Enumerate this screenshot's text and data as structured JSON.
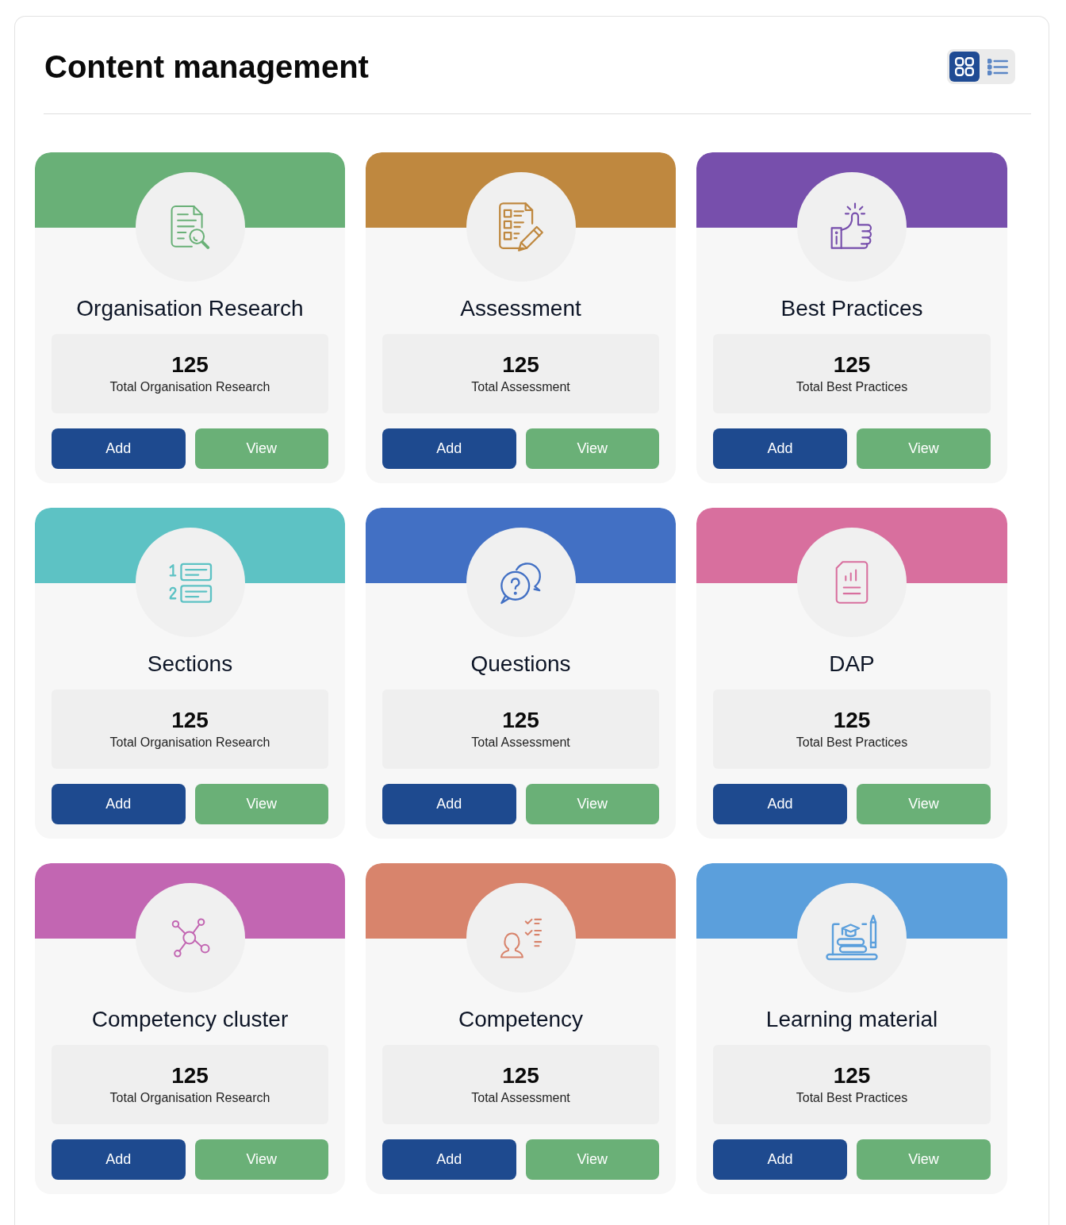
{
  "header": {
    "title": "Content management",
    "view_toggle": [
      {
        "kind": "grid",
        "selected": true
      },
      {
        "kind": "list",
        "selected": false
      }
    ]
  },
  "cards": [
    {
      "kind": "research",
      "title": "Organisation Research",
      "color": "#69b077",
      "count": "125",
      "count_label": "Total Organisation Research",
      "actions": [
        {
          "kind": "add",
          "label": "Add"
        },
        {
          "kind": "view",
          "label": "View"
        }
      ]
    },
    {
      "kind": "assessment",
      "title": "Assessment",
      "color": "#bf883f",
      "count": "125",
      "count_label": "Total Assessment",
      "actions": [
        {
          "kind": "add",
          "label": "Add"
        },
        {
          "kind": "view",
          "label": "View"
        }
      ]
    },
    {
      "kind": "best_practices",
      "title": "Best Practices",
      "color": "#774fac",
      "count": "125",
      "count_label": "Total Best Practices",
      "actions": [
        {
          "kind": "add",
          "label": "Add"
        },
        {
          "kind": "view",
          "label": "View"
        }
      ]
    },
    {
      "kind": "sections",
      "title": "Sections",
      "color": "#5dc2c4",
      "count": "125",
      "count_label": "Total Organisation Research",
      "actions": [
        {
          "kind": "add",
          "label": "Add"
        },
        {
          "kind": "view",
          "label": "View"
        }
      ]
    },
    {
      "kind": "questions",
      "title": "Questions",
      "color": "#4270c4",
      "count": "125",
      "count_label": "Total Assessment",
      "actions": [
        {
          "kind": "add",
          "label": "Add"
        },
        {
          "kind": "view",
          "label": "View"
        }
      ]
    },
    {
      "kind": "dap",
      "title": "DAP",
      "color": "#d86f9e",
      "count": "125",
      "count_label": "Total Best Practices",
      "actions": [
        {
          "kind": "add",
          "label": "Add"
        },
        {
          "kind": "view",
          "label": "View"
        }
      ]
    },
    {
      "kind": "cluster",
      "title": "Competency cluster",
      "color": "#c266b2",
      "count": "125",
      "count_label": "Total Organisation Research",
      "actions": [
        {
          "kind": "add",
          "label": "Add"
        },
        {
          "kind": "view",
          "label": "View"
        }
      ]
    },
    {
      "kind": "competency",
      "title": "Competency",
      "color": "#d8846c",
      "count": "125",
      "count_label": "Total Assessment",
      "actions": [
        {
          "kind": "add",
          "label": "Add"
        },
        {
          "kind": "view",
          "label": "View"
        }
      ]
    },
    {
      "kind": "learning",
      "title": "Learning material",
      "color": "#5b9fdc",
      "count": "125",
      "count_label": "Total Best Practices",
      "actions": [
        {
          "kind": "add",
          "label": "Add"
        },
        {
          "kind": "view",
          "label": "View"
        }
      ]
    }
  ]
}
